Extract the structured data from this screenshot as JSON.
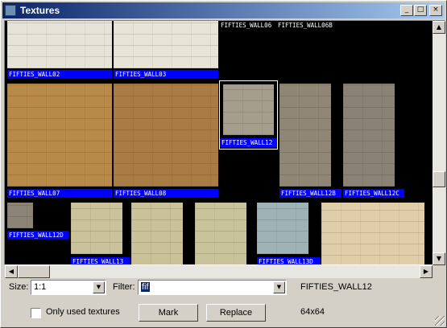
{
  "window": {
    "title": "Textures",
    "minimize_glyph": "_",
    "maximize_glyph": "□",
    "close_glyph": "×"
  },
  "textures": [
    {
      "name": "FIFTIES_WALL02",
      "swatch": "#e6e3d9",
      "selected": false
    },
    {
      "name": "FIFTIES_WALL03",
      "swatch": "#e8e4d6",
      "selected": false
    },
    {
      "name": "FIFTIES_WALL06",
      "swatch": "",
      "selected": false
    },
    {
      "name": "FIFTIES_WALL06B",
      "swatch": "",
      "selected": false
    },
    {
      "name": "FIFTIES_WALL07",
      "swatch": "#b88a4a",
      "selected": false
    },
    {
      "name": "FIFTIES_WALL08",
      "swatch": "#a97b45",
      "selected": false
    },
    {
      "name": "FIFTIES_WALL12",
      "swatch": "#a59e8c",
      "selected": true
    },
    {
      "name": "FIFTIES_WALL12B",
      "swatch": "#8f8676",
      "selected": false
    },
    {
      "name": "FIFTIES_WALL12C",
      "swatch": "#8a8274",
      "selected": false
    },
    {
      "name": "FIFTIES_WALL12D",
      "swatch": "#8c8577",
      "selected": false
    },
    {
      "name": "FIFTIES_WALL13",
      "swatch": "#c9c29a",
      "selected": false
    },
    {
      "name": "",
      "swatch": "#c8c19a",
      "selected": false
    },
    {
      "name": "",
      "swatch": "#c9c39c",
      "selected": false
    },
    {
      "name": "FIFTIES_WALL13D",
      "swatch": "#9fb3b6",
      "selected": false
    },
    {
      "name": "",
      "swatch": "#e0ceaa",
      "selected": false
    }
  ],
  "scrollbars": {
    "up_glyph": "▲",
    "down_glyph": "▼",
    "left_glyph": "◀",
    "right_glyph": "▶",
    "vertical_position": 0.68,
    "horizontal_position": 0.0
  },
  "controls": {
    "size_label": "Size:",
    "size_value": "1:1",
    "filter_label": "Filter:",
    "filter_value": "fif",
    "dropdown_glyph": "▼",
    "only_used_label": "Only used textures",
    "only_used_checked": false,
    "mark_label": "Mark",
    "replace_label": "Replace",
    "selected_name": "FIFTIES_WALL12",
    "selected_size": "64x64"
  }
}
